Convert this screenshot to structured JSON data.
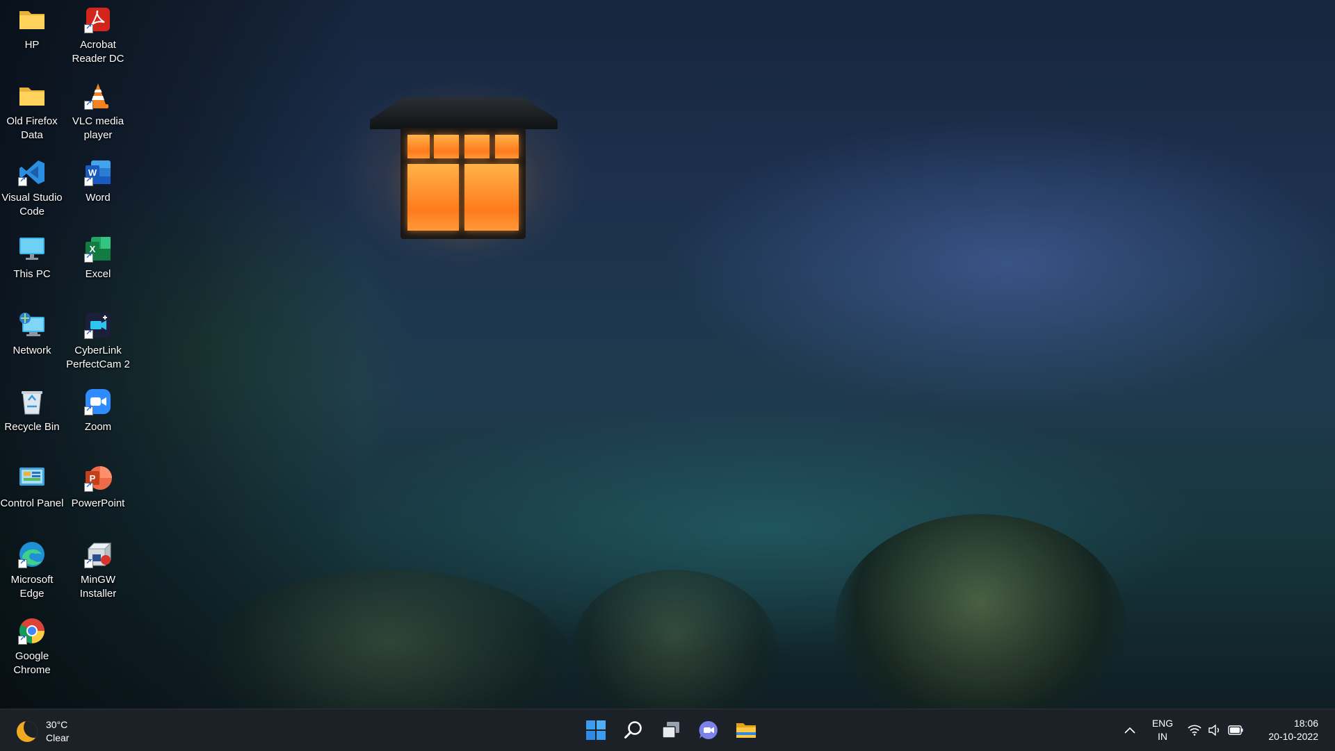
{
  "desktop": {
    "wallpaper": "night-forest-lantern",
    "icons": [
      {
        "label": "HP",
        "icon": "folder-icon"
      },
      {
        "label": "Acrobat Reader DC",
        "icon": "acrobat-icon"
      },
      {
        "label": "Old Firefox Data",
        "icon": "folder-icon"
      },
      {
        "label": "VLC media player",
        "icon": "vlc-icon"
      },
      {
        "label": "Visual Studio Code",
        "icon": "vscode-icon"
      },
      {
        "label": "Word",
        "icon": "word-icon"
      },
      {
        "label": "This PC",
        "icon": "monitor-icon"
      },
      {
        "label": "Excel",
        "icon": "excel-icon"
      },
      {
        "label": "Network",
        "icon": "network-icon"
      },
      {
        "label": "CyberLink PerfectCam 2",
        "icon": "perfectcam-icon"
      },
      {
        "label": "Recycle Bin",
        "icon": "recycle-bin-icon"
      },
      {
        "label": "Zoom",
        "icon": "zoom-icon"
      },
      {
        "label": "Control Panel",
        "icon": "control-panel-icon"
      },
      {
        "label": "PowerPoint",
        "icon": "powerpoint-icon"
      },
      {
        "label": "Microsoft Edge",
        "icon": "edge-icon"
      },
      {
        "label": "MinGW Installer",
        "icon": "mingw-icon"
      },
      {
        "label": "Google Chrome",
        "icon": "chrome-icon"
      }
    ]
  },
  "taskbar": {
    "weather": {
      "temperature": "30°C",
      "condition": "Clear",
      "icon": "moon-icon"
    },
    "apps": [
      {
        "name": "Start",
        "icon": "windows-start-icon"
      },
      {
        "name": "Search",
        "icon": "search-icon"
      },
      {
        "name": "Task View",
        "icon": "task-view-icon"
      },
      {
        "name": "Chat",
        "icon": "teams-chat-icon"
      },
      {
        "name": "File Explorer",
        "icon": "file-explorer-icon"
      }
    ],
    "tray": {
      "overflow_icon": "chevron-up-icon",
      "language_line1": "ENG",
      "language_line2": "IN",
      "wifi_icon": "wifi-icon",
      "volume_icon": "volume-icon",
      "battery_icon": "battery-icon",
      "time": "18:06",
      "date": "20-10-2022"
    }
  },
  "colors": {
    "taskbar_bg": "#1c2128",
    "lantern_glow": "#ff8a2a",
    "windows_blue": "#3b9cf0"
  }
}
